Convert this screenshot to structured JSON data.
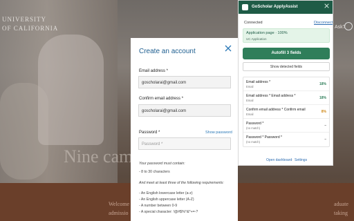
{
  "background": {
    "logo_line1": "UNIVERSITY",
    "logo_line2": "OF CALIFORNIA",
    "hero_text": "Nine cam",
    "bottom_left_1": "Welcome",
    "bottom_left_2": "admissio",
    "bottom_right_1": "aduate",
    "bottom_right_2": "taking",
    "ask_text": "Ask?"
  },
  "modal": {
    "title": "Create an account",
    "close_icon": "close-icon",
    "email_label": "Email address *",
    "email_value": "goscholarai@gmail.com",
    "confirm_label": "Confirm email address *",
    "confirm_value": "goscholarai@gmail.com",
    "password_label": "Password *",
    "show_password": "Show password",
    "password_placeholder": "Password *",
    "rules_intro": "Your password must contain:",
    "rule_length": "- 8 to 30 characters",
    "rules_more": "And meet at least three of the following requirements:",
    "rule_lower": "- An English lowercase letter (a-z)",
    "rule_upper": "- An English uppercase letter (A-Z)",
    "rule_number": "- A number between 0-9",
    "rule_special": "- A special character: !@#$%^&*+=-?"
  },
  "extension": {
    "title": "GoScholar ApplyAssist",
    "close_icon": "close-icon",
    "status": "Connected",
    "disconnect": "Disconnect",
    "banner_title": "Application page · 100%",
    "banner_sub": "UC Application",
    "autofill_button": "Autofill 3 fields",
    "show_fields": "Show detected fields",
    "fields": [
      {
        "name": "Email address *",
        "type": "Email",
        "pct": "18%",
        "color": "#2f7e5a"
      },
      {
        "name": "Email address * Email address *",
        "type": "Email",
        "pct": "18%",
        "color": "#2f7e5a"
      },
      {
        "name": "Confirm email address * Confirm email",
        "type": "Email",
        "pct": "8%",
        "color": "#d08a1a"
      },
      {
        "name": "Password *",
        "type": "(no match)",
        "pct": "–",
        "color": "#666666"
      },
      {
        "name": "Password * Password *",
        "type": "(no match)",
        "pct": "–",
        "color": "#666666"
      }
    ],
    "footer_dashboard": "Open dashboard",
    "footer_sep": "·",
    "footer_settings": "Settings"
  }
}
